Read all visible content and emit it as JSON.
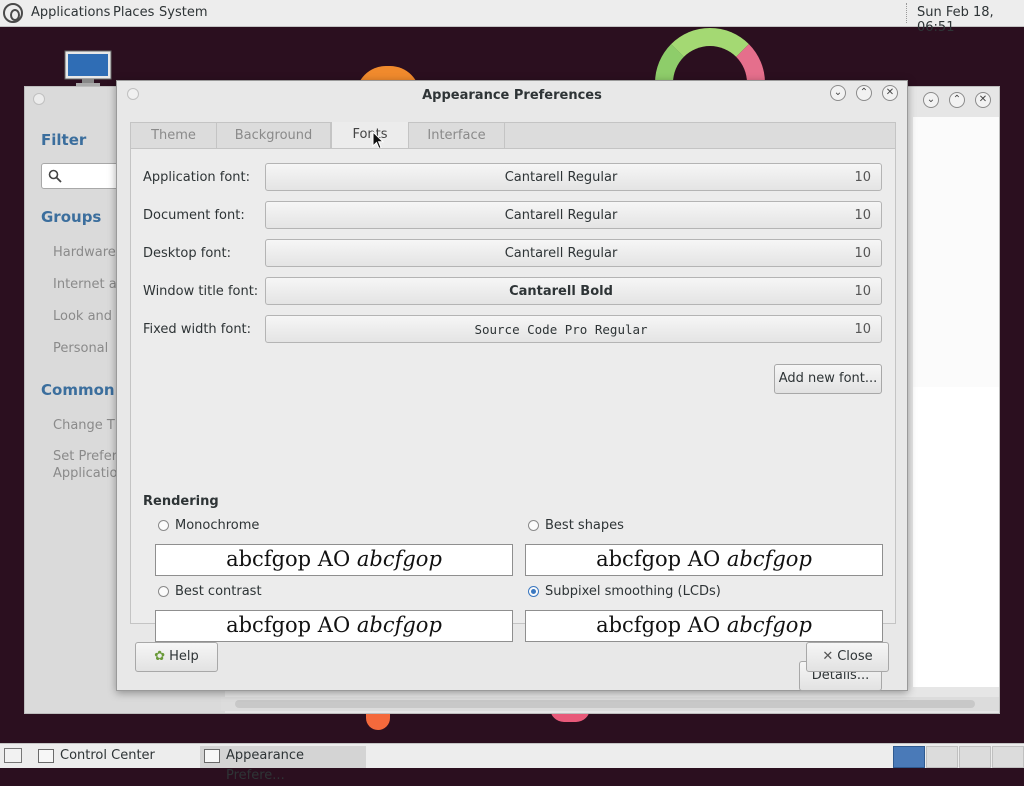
{
  "top_panel": {
    "menus": [
      "Applications",
      "Places",
      "System"
    ],
    "clock": "Sun Feb 18, 06:51"
  },
  "control_center": {
    "filter_heading": "Filter",
    "groups_heading": "Groups",
    "groups": [
      "Hardware",
      "Internet ar",
      "Look and F",
      "Personal"
    ],
    "common_heading": "Common T",
    "common_tasks": [
      "Change Th",
      "Set Preferr",
      "Application"
    ]
  },
  "dialog": {
    "title": "Appearance Preferences",
    "tabs": [
      "Theme",
      "Background",
      "Fonts",
      "Interface"
    ],
    "active_tab": "Fonts",
    "fonts": [
      {
        "label": "Application font:",
        "name": "Cantarell Regular",
        "size": "10"
      },
      {
        "label": "Document font:",
        "name": "Cantarell Regular",
        "size": "10"
      },
      {
        "label": "Desktop font:",
        "name": "Cantarell Regular",
        "size": "10"
      },
      {
        "label": "Window title font:",
        "name": "Cantarell Bold",
        "size": "10"
      },
      {
        "label": "Fixed width font:",
        "name": "Source Code Pro Regular",
        "size": "10"
      }
    ],
    "add_font_button": "Add new font...",
    "rendering_heading": "Rendering",
    "rendering_options": [
      {
        "label": "Monochrome",
        "selected": false,
        "sample_regular": "abcfgop AO ",
        "sample_italic": "abcfgop"
      },
      {
        "label": "Best shapes",
        "selected": false,
        "sample_regular": "abcfgop AO ",
        "sample_italic": "abcfgop"
      },
      {
        "label": "Best contrast",
        "selected": false,
        "sample_regular": "abcfgop AO ",
        "sample_italic": "abcfgop"
      },
      {
        "label": "Subpixel smoothing (LCDs)",
        "selected": true,
        "sample_regular": "abcfgop AO ",
        "sample_italic": "abcfgop"
      }
    ],
    "details_button": "Details...",
    "help_button": "Help",
    "close_button": "Close"
  },
  "taskbar": {
    "tasks": [
      {
        "label": "Control Center",
        "active": false
      },
      {
        "label": "Appearance Prefere...",
        "active": true
      }
    ]
  },
  "colors": {
    "accent": "#3b78c0",
    "heading_blue": "#3b6e9d",
    "desktop_bg": "#2b0f1f"
  }
}
